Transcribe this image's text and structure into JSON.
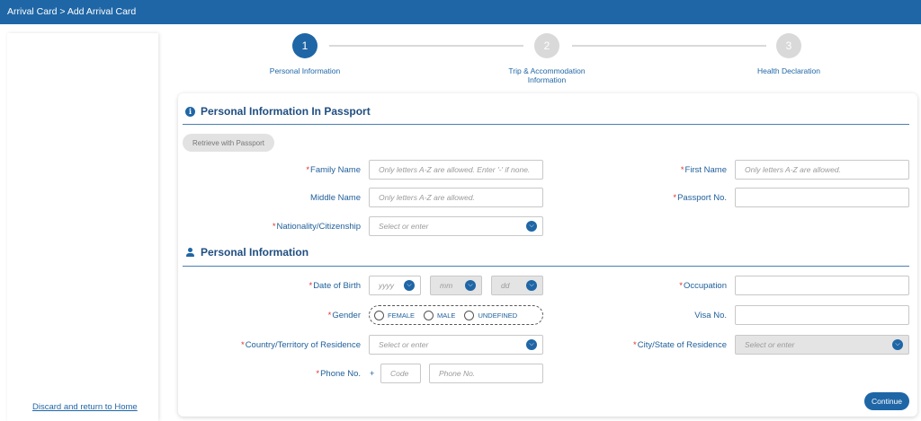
{
  "header": {
    "breadcrumb": "Arrival Card > Add Arrival Card"
  },
  "sidebar": {
    "discard_link": "Discard and return to Home"
  },
  "steps": [
    {
      "number": "1",
      "label": "Personal Information",
      "active": true
    },
    {
      "number": "2",
      "label_line1": "Trip & Accommodation",
      "label_line2": "Information",
      "active": false
    },
    {
      "number": "3",
      "label": "Health Declaration",
      "active": false
    }
  ],
  "passport_section": {
    "title": "Personal Information In Passport",
    "retrieve_button": "Retrieve with Passport",
    "family_name": {
      "label": "Family Name",
      "placeholder": "Only letters A-Z are allowed. Enter '-' if none."
    },
    "first_name": {
      "label": "First Name",
      "placeholder": "Only letters A-Z are allowed."
    },
    "middle_name": {
      "label": "Middle Name",
      "placeholder": "Only letters A-Z are allowed."
    },
    "passport_no": {
      "label": "Passport No.",
      "placeholder": ""
    },
    "nationality": {
      "label": "Nationality/Citizenship",
      "placeholder": "Select or enter"
    }
  },
  "personal_section": {
    "title": "Personal Information",
    "dob": {
      "label": "Date of Birth",
      "year": "yyyy",
      "month": "mm",
      "day": "dd"
    },
    "occupation": {
      "label": "Occupation"
    },
    "gender": {
      "label": "Gender",
      "options": [
        "FEMALE",
        "MALE",
        "UNDEFINED"
      ]
    },
    "visa_no": {
      "label": "Visa No."
    },
    "country_residence": {
      "label": "Country/Territory of Residence",
      "placeholder": "Select or enter"
    },
    "city_residence": {
      "label": "City/State of Residence",
      "placeholder": "Select or enter"
    },
    "phone": {
      "label": "Phone No.",
      "plus": "+",
      "code_placeholder": "Code",
      "number_placeholder": "Phone No."
    }
  },
  "actions": {
    "continue": "Continue"
  },
  "colors": {
    "primary": "#1f66a6",
    "required": "#e0322a",
    "disabled": "#e4e4e4"
  }
}
